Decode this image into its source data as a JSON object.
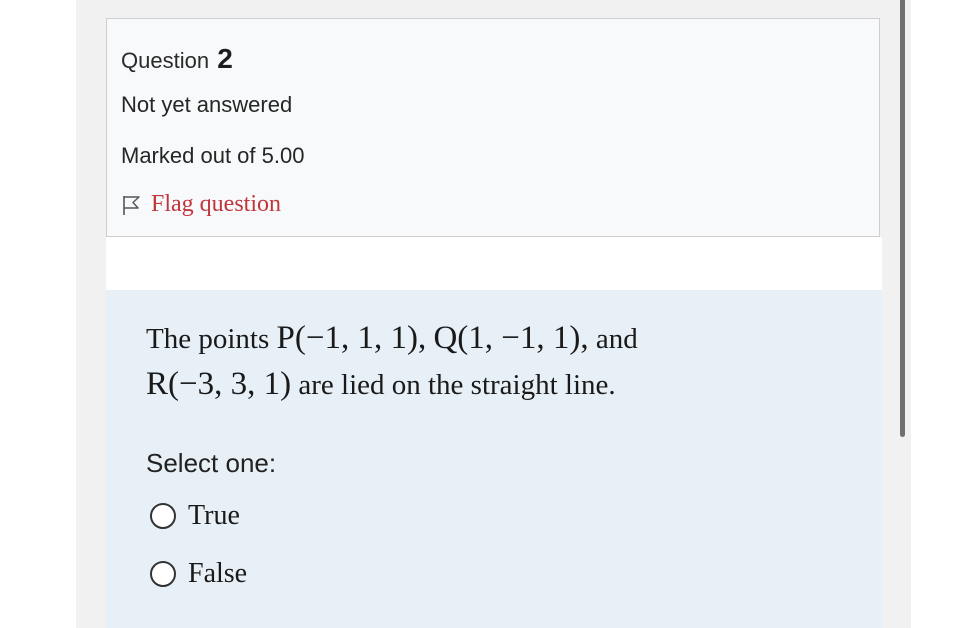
{
  "question": {
    "label": "Question",
    "number": "2",
    "state": "Not yet answered",
    "grade": "Marked out of 5.00",
    "flag_label": "Flag question"
  },
  "content": {
    "text_line1_prefix": "The points ",
    "point_p": "P(−1, 1, 1),",
    "point_q": "Q(1, −1, 1),",
    "text_line1_suffix": " and",
    "point_r": "R(−3, 3, 1)",
    "text_line2_suffix": " are  lied  on the straight line.",
    "prompt": "Select one:",
    "options": [
      {
        "label": "True",
        "selected": false
      },
      {
        "label": "False",
        "selected": false
      }
    ]
  },
  "colors": {
    "flag_text": "#c0363c",
    "content_bg": "#e7f0f6",
    "info_bg": "#f8f9fa"
  }
}
